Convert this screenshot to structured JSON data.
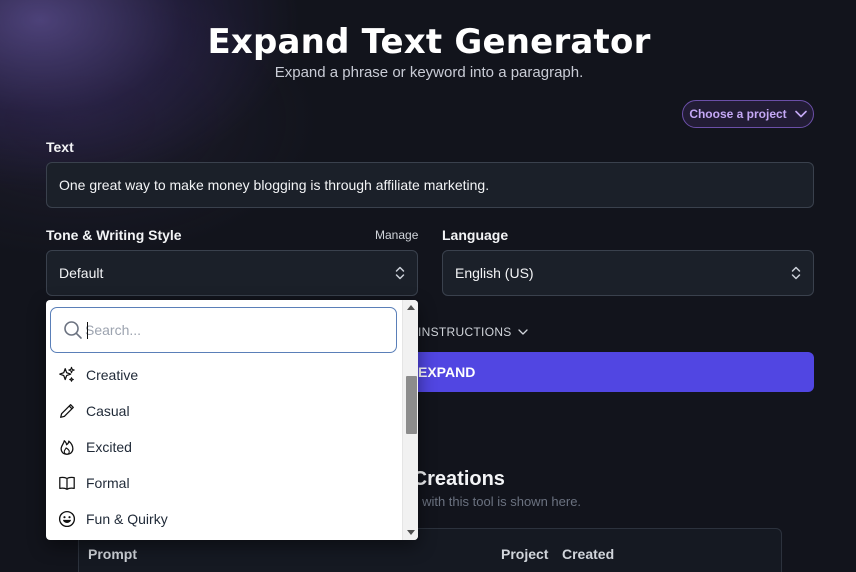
{
  "header": {
    "title": "Expand Text Generator",
    "subtitle": "Expand a phrase or keyword into a paragraph."
  },
  "project_selector": {
    "label": "Choose a project"
  },
  "text_field": {
    "label": "Text",
    "value": "One great way to make money blogging is through affiliate marketing."
  },
  "tone": {
    "label": "Tone & Writing Style",
    "manage_label": "Manage",
    "selected": "Default"
  },
  "language": {
    "label": "Language",
    "selected": "English (US)"
  },
  "instructions_toggle": {
    "label": "INSTRUCTIONS"
  },
  "expand_button": {
    "label": "EXPAND"
  },
  "creations": {
    "title": "s Creations",
    "subtitle": "ed with this tool is shown here.",
    "columns": [
      "Prompt",
      "Project",
      "Created"
    ]
  },
  "tone_dropdown": {
    "search_placeholder": "Search...",
    "items": [
      {
        "label": "Creative",
        "icon": "sparkles-icon"
      },
      {
        "label": "Casual",
        "icon": "pencil-icon"
      },
      {
        "label": "Excited",
        "icon": "fire-icon"
      },
      {
        "label": "Formal",
        "icon": "book-icon"
      },
      {
        "label": "Fun & Quirky",
        "icon": "smiley-icon"
      }
    ]
  },
  "colors": {
    "background": "#12141c",
    "accent": "#5146e2",
    "project_button_text": "#c4a8f5"
  }
}
